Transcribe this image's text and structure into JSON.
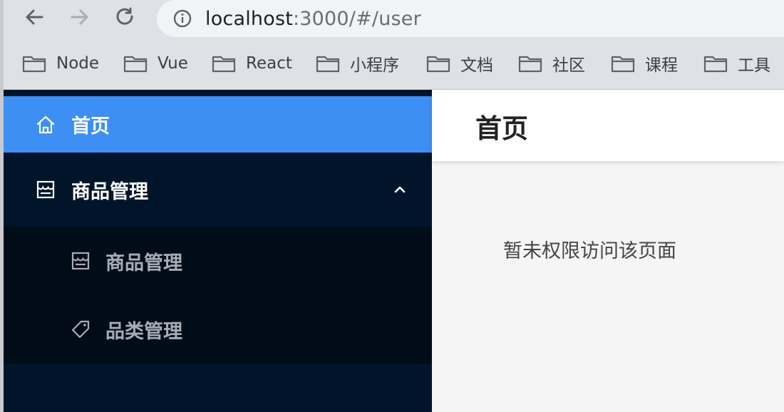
{
  "browser": {
    "url_host": "localhost",
    "url_rest": ":3000/#/user",
    "bookmarks": [
      {
        "label": "Node"
      },
      {
        "label": "Vue"
      },
      {
        "label": "React"
      },
      {
        "label": "小程序"
      },
      {
        "label": "文档"
      },
      {
        "label": "社区"
      },
      {
        "label": "课程"
      },
      {
        "label": "工具"
      }
    ]
  },
  "sidebar": {
    "home": {
      "label": "首页",
      "icon": "home-icon"
    },
    "goods": {
      "label": "商品管理",
      "icon": "shop-icon",
      "expanded": true
    },
    "submenu": [
      {
        "label": "商品管理",
        "icon": "shop-icon"
      },
      {
        "label": "品类管理",
        "icon": "tag-icon"
      }
    ]
  },
  "main": {
    "title": "首页",
    "message": "暂未权限访问该页面"
  },
  "colors": {
    "sidebar_bg": "#001529",
    "submenu_bg": "#000c17",
    "active_bg": "#3d8ff4",
    "content_bg": "#f5f5f5"
  }
}
